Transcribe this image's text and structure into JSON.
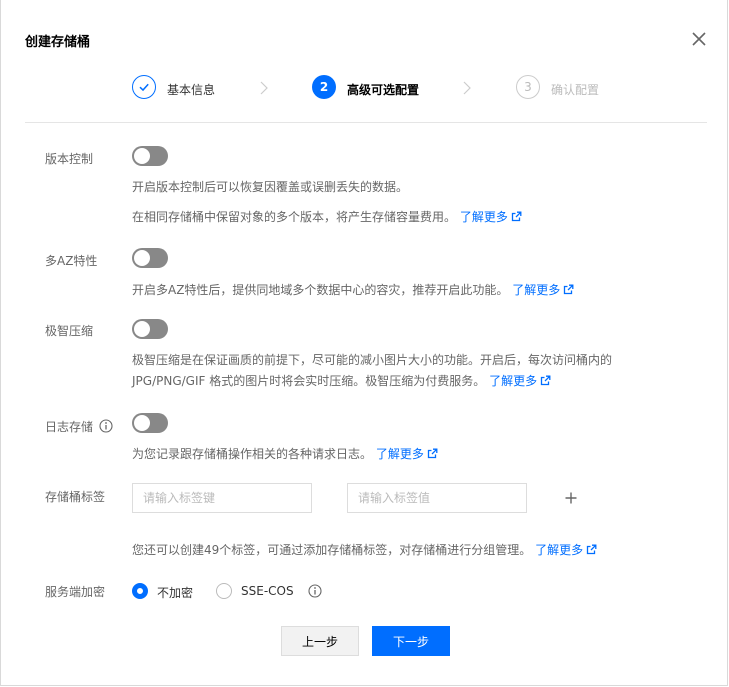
{
  "dialog": {
    "title": "创建存储桶"
  },
  "steps": [
    {
      "number": "1",
      "label": "基本信息",
      "status": "done"
    },
    {
      "number": "2",
      "label": "高级可选配置",
      "status": "active"
    },
    {
      "number": "3",
      "label": "确认配置",
      "status": "pending"
    }
  ],
  "settings": {
    "versioning": {
      "label": "版本控制",
      "enabled": false,
      "desc_line1": "开启版本控制后可以恢复因覆盖或误删丢失的数据。",
      "desc_line2": "在相同存储桶中保留对象的多个版本，将产生存储容量费用。",
      "link": "了解更多"
    },
    "multi_az": {
      "label": "多AZ特性",
      "enabled": false,
      "desc_line1": "开启多AZ特性后，提供同地域多个数据中心的容灾，推荐开启此功能。",
      "link": "了解更多"
    },
    "compression": {
      "label": "极智压缩",
      "enabled": false,
      "desc_line1": "极智压缩是在保证画质的前提下，尽可能的减小图片大小的功能。开启后，每次访问桶内的",
      "desc_line2": "JPG/PNG/GIF 格式的图片时将会实时压缩。极智压缩为付费服务。",
      "link": "了解更多"
    },
    "logging": {
      "label": "日志存储",
      "enabled": false,
      "desc_line1": "为您记录跟存储桶操作相关的各种请求日志。",
      "link": "了解更多"
    },
    "tags": {
      "label": "存储桶标签",
      "key_placeholder": "请输入标签键",
      "value_placeholder": "请输入标签值",
      "key_value": "",
      "value_value": "",
      "desc_line1": "您还可以创建49个标签，可通过添加存储桶标签，对存储桶进行分组管理。",
      "link": "了解更多"
    },
    "encryption": {
      "label": "服务端加密",
      "selected": "不加密",
      "options": [
        "不加密",
        "SSE-COS"
      ]
    }
  },
  "buttons": {
    "prev": "上一步",
    "next": "下一步"
  },
  "colors": {
    "accent": "#006eff",
    "toggle_off": "#888888",
    "label_text": "#666666",
    "disabled_text": "#bbbbbb"
  },
  "icons": {
    "close": "close-icon",
    "step_done": "check-icon",
    "chevron": "chevron-right-icon",
    "external": "external-link-icon",
    "info": "info-icon",
    "add": "plus-icon"
  }
}
